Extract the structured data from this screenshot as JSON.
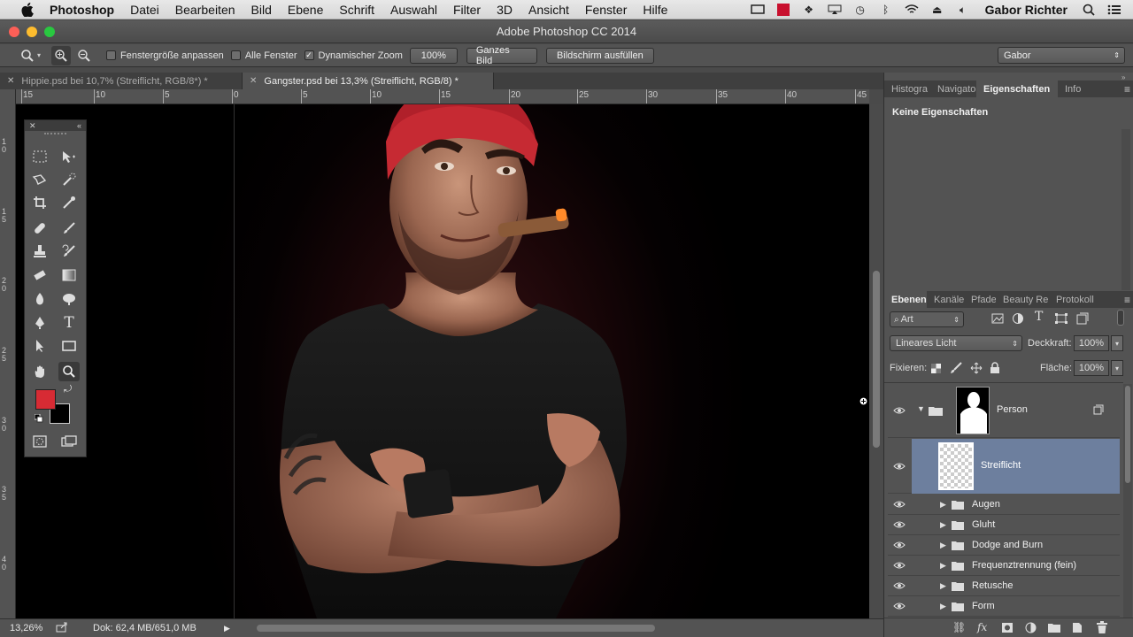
{
  "menubar": {
    "app": "Photoshop",
    "items": [
      "Datei",
      "Bearbeiten",
      "Bild",
      "Ebene",
      "Schrift",
      "Auswahl",
      "Filter",
      "3D",
      "Ansicht",
      "Fenster",
      "Hilfe"
    ],
    "user": "Gabor Richter",
    "status_icons": [
      "display-icon",
      "adobe-icon",
      "dropbox-icon",
      "airplay-icon",
      "time-machine-icon",
      "bluetooth-icon",
      "wifi-icon",
      "eject-icon",
      "volume-icon"
    ]
  },
  "window": {
    "title": "Adobe Photoshop CC 2014"
  },
  "options": {
    "chk_fit": "Fenstergröße anpassen",
    "chk_all": "Alle Fenster",
    "chk_dyn": "Dynamischer Zoom",
    "zoom_value": "100%",
    "btn_fit": "Ganzes Bild",
    "btn_fill": "Bildschirm ausfüllen",
    "workspace": "Gabor",
    "chk_fit_checked": false,
    "chk_all_checked": false,
    "chk_dyn_checked": true
  },
  "tabs": [
    {
      "label": "Hippie.psd bei 10,7% (Streiflicht, RGB/8*) *",
      "active": false
    },
    {
      "label": "Gangster.psd bei 13,3% (Streiflicht, RGB/8) *",
      "active": true
    }
  ],
  "ruler": {
    "h_labels": [
      "15",
      "10",
      "5",
      "0",
      "5",
      "10",
      "15",
      "20",
      "25",
      "30",
      "35",
      "40",
      "45"
    ],
    "v_labels": [
      "1\n0",
      "1\n5",
      "2\n0",
      "2\n5",
      "3\n0",
      "3\n5",
      "4\n0"
    ]
  },
  "status": {
    "zoom": "13,26%",
    "doc": "Dok: 62,4 MB/651,0 MB"
  },
  "colors": {
    "foreground": "#d72b34",
    "background": "#000000",
    "selection": "#6d7f9e"
  },
  "properties": {
    "tabs": [
      "Histogra",
      "Navigato",
      "Eigenschaften",
      "Info"
    ],
    "active_tab": "Eigenschaften",
    "content": "Keine Eigenschaften"
  },
  "layers_panel": {
    "tabs": [
      "Ebenen",
      "Kanäle",
      "Pfade",
      "Beauty Rei",
      "Protokoll"
    ],
    "active_tab": "Ebenen",
    "filter": "Art",
    "blend_mode": "Lineares Licht",
    "opacity_label": "Deckkraft:",
    "opacity": "100%",
    "lock_label": "Fixieren:",
    "fill_label": "Fläche:",
    "fill": "100%",
    "layers": [
      {
        "name": "Person",
        "type": "group-mask"
      },
      {
        "name": "Streiflicht",
        "type": "layer",
        "selected": true
      },
      {
        "name": "Augen",
        "type": "group"
      },
      {
        "name": "Gluht",
        "type": "group"
      },
      {
        "name": "Dodge and Burn",
        "type": "group"
      },
      {
        "name": "Frequenztrennung (fein)",
        "type": "group"
      },
      {
        "name": "Retusche",
        "type": "group"
      },
      {
        "name": "Form",
        "type": "group"
      }
    ]
  }
}
